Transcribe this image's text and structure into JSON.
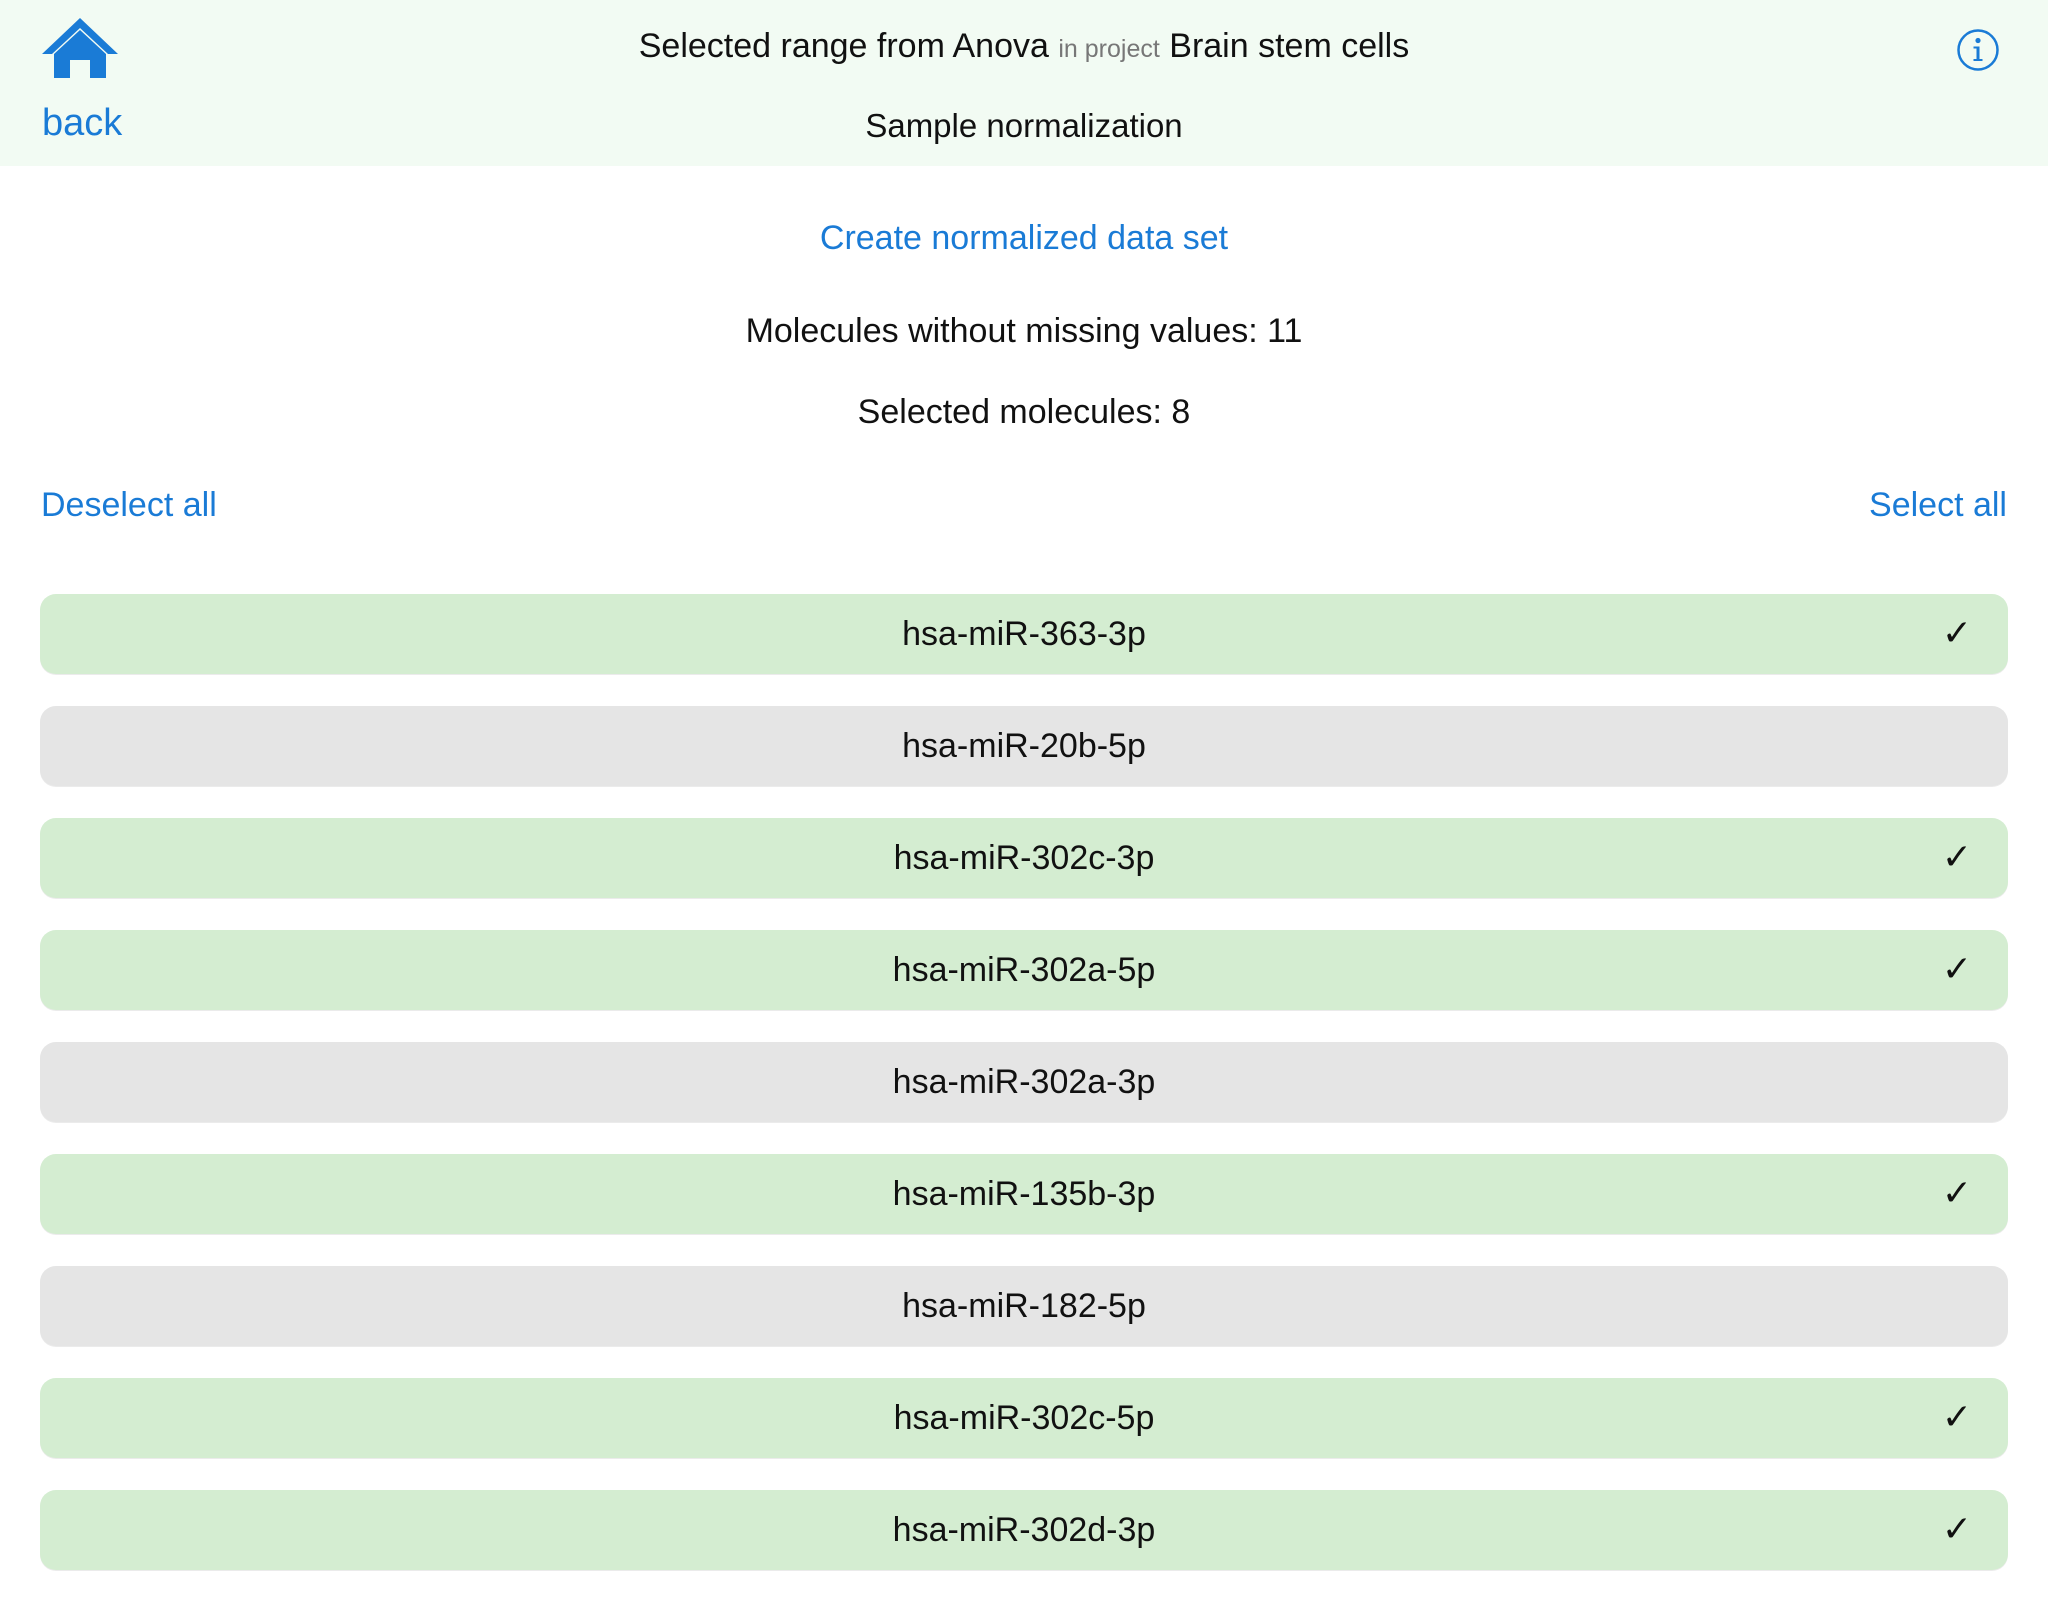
{
  "header": {
    "title_prefix": "Selected range from Anova",
    "title_mid": "in project",
    "title_project": "Brain stem cells",
    "subtitle": "Sample normalization",
    "back_label": "back",
    "home_icon": "home-icon",
    "info_icon": "info-icon"
  },
  "actions": {
    "create_label": "Create normalized data set",
    "deselect_all_label": "Deselect all",
    "select_all_label": "Select all"
  },
  "stats": {
    "without_missing": "Molecules without missing values: 11",
    "selected": "Selected molecules: 8"
  },
  "colors": {
    "accent": "#1a7bd6",
    "header_bg": "#f2fbf3",
    "selected_row": "#d4edd1",
    "unselected_row": "#e5e5e5"
  },
  "check_mark": "✓",
  "molecules": [
    {
      "name": "hsa-miR-363-3p",
      "selected": true
    },
    {
      "name": "hsa-miR-20b-5p",
      "selected": false
    },
    {
      "name": "hsa-miR-302c-3p",
      "selected": true
    },
    {
      "name": "hsa-miR-302a-5p",
      "selected": true
    },
    {
      "name": "hsa-miR-302a-3p",
      "selected": false
    },
    {
      "name": "hsa-miR-135b-3p",
      "selected": true
    },
    {
      "name": "hsa-miR-182-5p",
      "selected": false
    },
    {
      "name": "hsa-miR-302c-5p",
      "selected": true
    },
    {
      "name": "hsa-miR-302d-3p",
      "selected": true
    }
  ]
}
